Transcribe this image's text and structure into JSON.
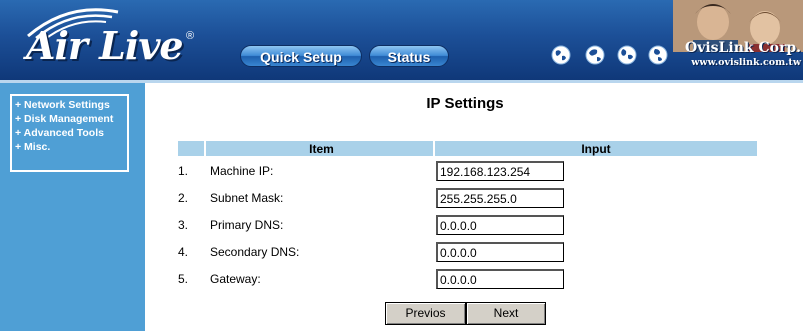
{
  "header": {
    "logo_text": "Air Live",
    "logo_reg": "®",
    "nav": [
      {
        "label": "Quick Setup"
      },
      {
        "label": "Status"
      }
    ],
    "company": "OvisLink Corp.",
    "url": "www.ovislink.com.tw"
  },
  "sidebar": {
    "items": [
      {
        "label": "+ Network Settings"
      },
      {
        "label": "+ Disk Management"
      },
      {
        "label": "+ Advanced Tools"
      },
      {
        "label": "+ Misc."
      }
    ]
  },
  "main": {
    "title": "IP Settings",
    "columns": {
      "item": "Item",
      "input": "Input"
    },
    "rows": [
      {
        "num": "1.",
        "label": "Machine IP:",
        "value": "192.168.123.254"
      },
      {
        "num": "2.",
        "label": "Subnet Mask:",
        "value": "255.255.255.0"
      },
      {
        "num": "3.",
        "label": "Primary DNS:",
        "value": "0.0.0.0"
      },
      {
        "num": "4.",
        "label": "Secondary DNS:",
        "value": "0.0.0.0"
      },
      {
        "num": "5.",
        "label": "Gateway:",
        "value": "0.0.0.0"
      }
    ],
    "buttons": {
      "previous": "Previos",
      "next": "Next"
    }
  },
  "colors": {
    "header_blue": "#1c4f97",
    "sidebar_blue": "#4f9fd5",
    "table_header": "#a9d1e9"
  }
}
